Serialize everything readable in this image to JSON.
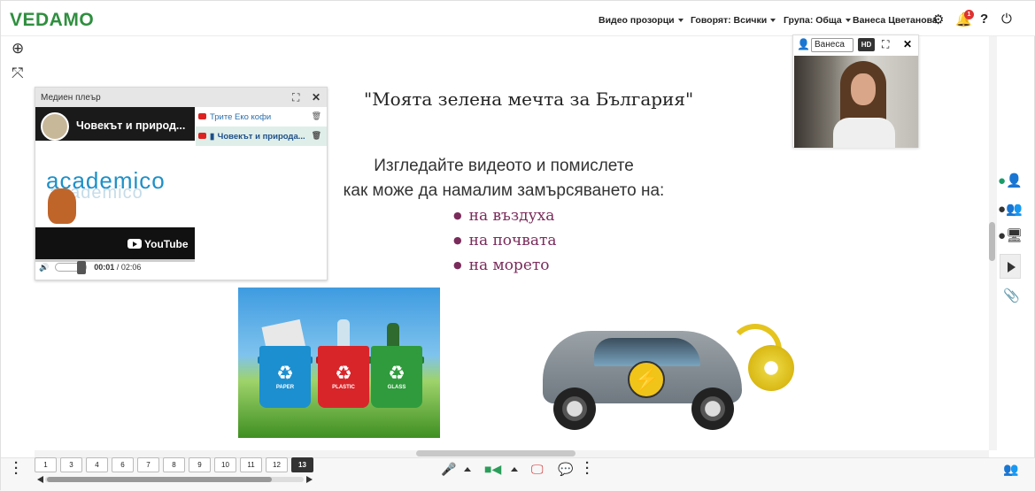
{
  "brand": {
    "logo": "VEDAMO",
    "accent": "#2f8f3f"
  },
  "topbar": {
    "video_windows": "Видео прозорци",
    "speakers": "Говорят: Всички",
    "group": "Група: Обща",
    "user_name": "Ванеса Цветанова",
    "notifications_count": "1",
    "icons": [
      "gear-icon",
      "bell-icon",
      "help-icon",
      "power-icon"
    ]
  },
  "left_tools": [
    "zoom-in-icon",
    "fit-screen-icon"
  ],
  "slide": {
    "title": "\"Моята зелена мечта за България\"",
    "line1": "Изгледайте видеото и помислете",
    "line2": "как може да намалим замърсяването на:",
    "bullets": [
      "на въздуха",
      "на почвата",
      "на морето"
    ]
  },
  "media_player": {
    "title": "Медиен плеър",
    "video_title": "Човекът и природ...",
    "brand_text": "academico",
    "youtube_label": "YouTube",
    "time_current": "00:01",
    "time_separator": "/",
    "time_total": "02:06",
    "playlist": [
      {
        "label": "Трите Еко кофи",
        "active": false
      },
      {
        "label": "Човекът и природа...",
        "active": true
      }
    ]
  },
  "bins": {
    "labels": [
      "PAPER",
      "PLASTIC",
      "GLASS"
    ],
    "colors": [
      "#1c8fd0",
      "#d8252a",
      "#2f9b3c"
    ]
  },
  "webcam": {
    "participant_select": "Ванеса",
    "hd_label": "HD"
  },
  "right_tools": [
    "user-chat-icon",
    "group-chat-icon",
    "screen-share-chat-icon",
    "play-panel-icon",
    "attachment-icon"
  ],
  "pager": {
    "pages": [
      "1",
      "3",
      "4",
      "6",
      "7",
      "8",
      "9",
      "10",
      "11",
      "12",
      "13"
    ],
    "active_page": "13"
  },
  "bottom_controls": [
    "microphone-icon",
    "camera-icon",
    "screen-share-icon",
    "chat-icon",
    "more-icon",
    "participants-icon"
  ]
}
